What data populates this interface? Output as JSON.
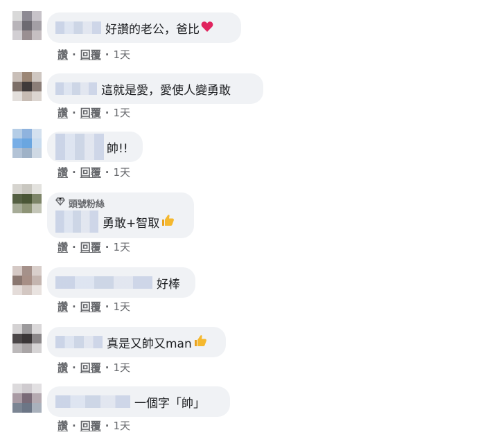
{
  "actions": {
    "like": "讚",
    "reply": "回覆",
    "separator": "·"
  },
  "badge_label": "頭號粉絲",
  "comments": [
    {
      "text": "好讚的老公，爸比",
      "emoji": "heart-icon",
      "time": "1天"
    },
    {
      "text": "這就是愛，愛使人變勇敢",
      "time": "1天"
    },
    {
      "text": "帥!!",
      "time": "1天"
    },
    {
      "text": "勇敢+智取",
      "emoji": "thumbs-up-icon",
      "time": "1天",
      "badge": true
    },
    {
      "text": "好棒",
      "time": "1天"
    },
    {
      "text": "真是又帥又man",
      "emoji": "thumbs-up-icon",
      "time": "1天"
    },
    {
      "text": "一個字「帥」",
      "time": "1天"
    }
  ],
  "colors": {
    "bubble": "#f0f2f5",
    "meta": "#65676b",
    "text": "#1c1e21",
    "heart": "#e0245e",
    "thumb": "#f5b82e"
  }
}
